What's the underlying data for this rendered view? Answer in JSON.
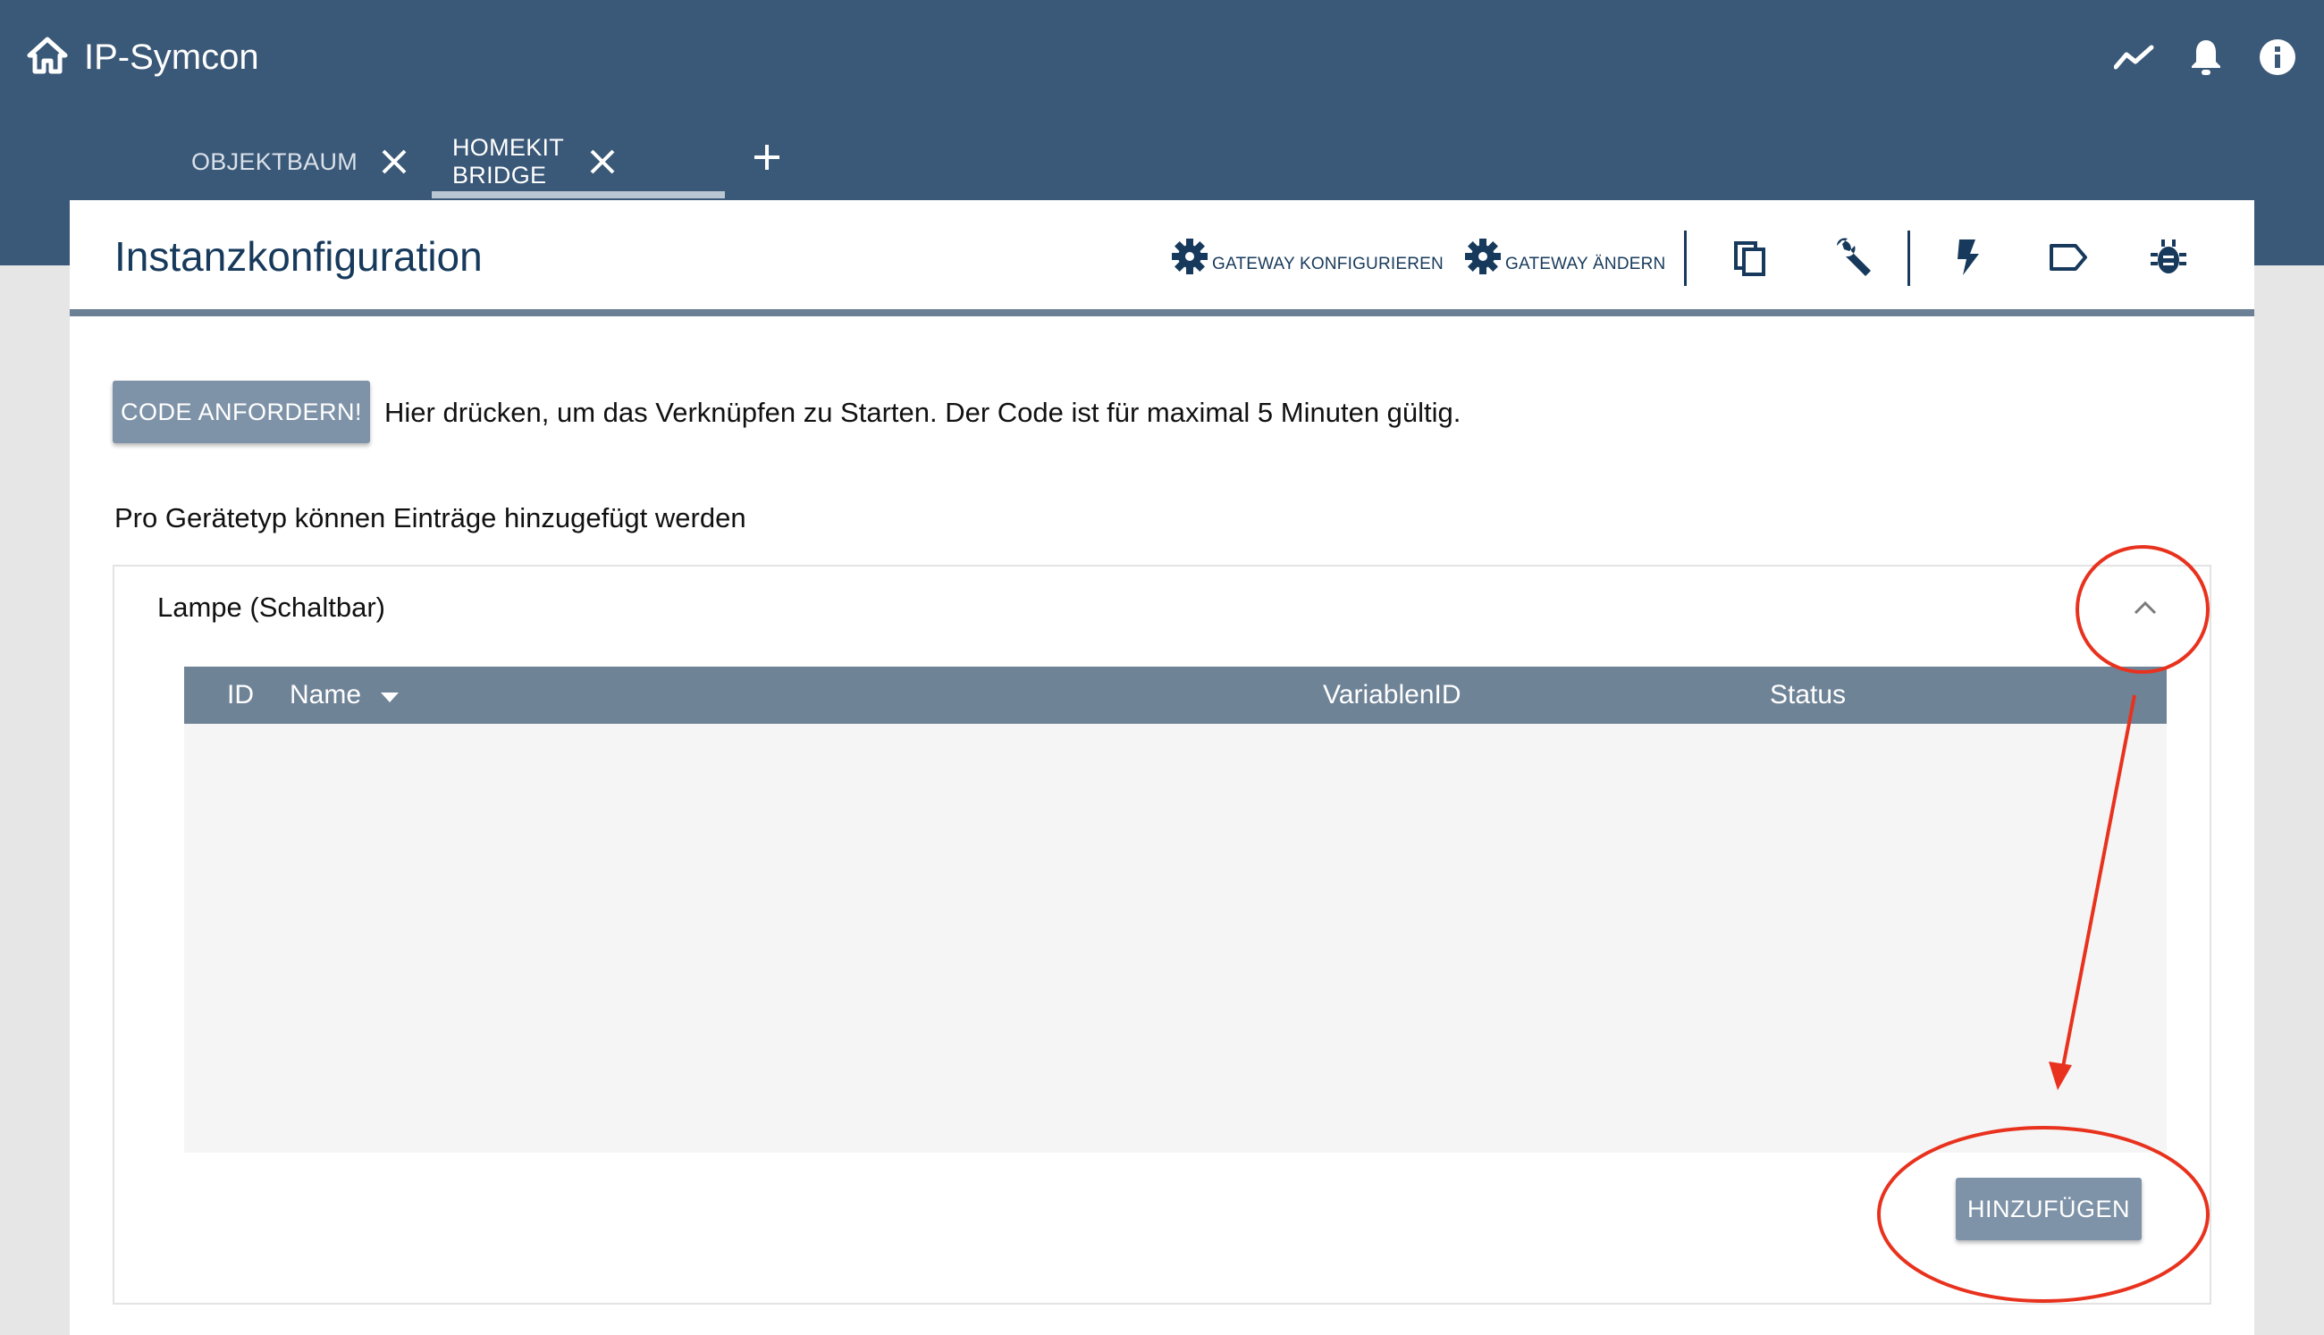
{
  "app": {
    "title": "IP-Symcon",
    "icons": [
      "home-icon",
      "trend-icon",
      "bell-icon",
      "info-icon",
      "apps-grid-icon"
    ]
  },
  "tabs": [
    {
      "label": "OBJEKTBAUM",
      "active": false
    },
    {
      "label": "HOMEKIT BRIDGE",
      "active": true
    }
  ],
  "page": {
    "title": "Instanzkonfiguration",
    "header_buttons": {
      "gateway_configure": "GATEWAY KONFIGURIEREN",
      "gateway_change": "GATEWAY ÄNDERN"
    },
    "header_icons": [
      "copy-icon",
      "wrench-icon",
      "flash-icon",
      "label-icon",
      "bug-icon"
    ]
  },
  "content": {
    "code_button": "CODE ANFORDERN!",
    "code_text": "Hier drücken, um das Verknüpfen zu Starten. Der Code ist für maximal 5 Minuten gültig.",
    "section_text": "Pro Gerätetyp können Einträge hinzugefügt werden",
    "card": {
      "title": "Lampe (Schaltbar)",
      "columns": [
        "ID",
        "Name",
        "VariablenID",
        "Status"
      ],
      "rows": [],
      "add_button": "HINZUFÜGEN"
    }
  },
  "colors": {
    "topbar": "#3a5877",
    "title": "#173a5c",
    "button": "#7f93a8",
    "table_header": "#6f8397",
    "annotation": "#e8321e"
  }
}
